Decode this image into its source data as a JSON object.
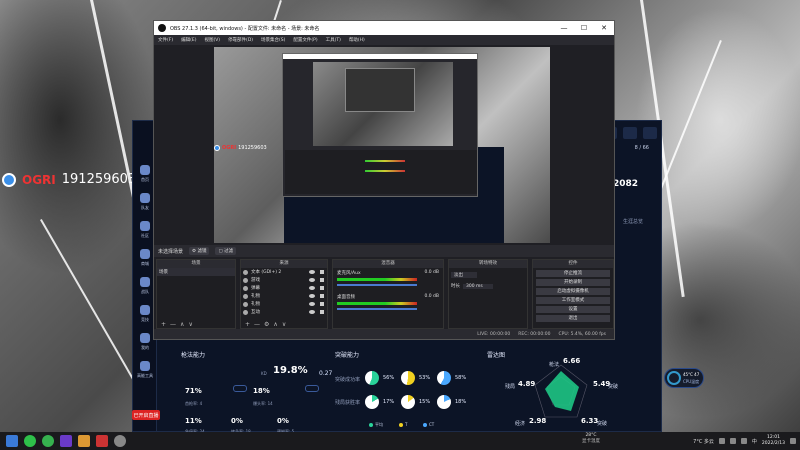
{
  "desktop": {
    "brand": "OGRI",
    "room_id": "191259603"
  },
  "obs": {
    "title": "OBS 27.1.3 (64-bit, windows) - 配置文件: 未命名 - 场景: 未命名",
    "menu": [
      "文件(F)",
      "编辑(E)",
      "视图(V)",
      "停靠部件(D)",
      "场景集合(S)",
      "配置文件(P)",
      "工具(T)",
      "帮助(H)"
    ],
    "window_controls": {
      "minimize": "—",
      "maximize": "☐",
      "close": "✕"
    },
    "scene_strip": {
      "name": "未选择场景",
      "btn1": "⚙ 滤镜",
      "btn2": "▢ 过滤"
    },
    "docks": {
      "scenes": {
        "title": "场景",
        "items": [
          "场景"
        ]
      },
      "sources": {
        "title": "来源",
        "items": [
          "文本 (GDI+) 2",
          "游戏",
          "弹幕",
          "礼物",
          "礼物",
          "互动"
        ]
      },
      "mixer": {
        "title": "混音器",
        "channels": [
          {
            "name": "麦克风/Aux",
            "db": "0.0 dB"
          },
          {
            "name": "桌面音频",
            "db": "0.0 dB"
          }
        ]
      },
      "transitions": {
        "title": "转场特效",
        "type": "淡出",
        "duration_label": "时长",
        "duration": "300 ms"
      },
      "controls": {
        "title": "控件",
        "buttons": [
          "停止推流",
          "开始录制",
          "启动虚拟摄像机",
          "工作室模式",
          "设置",
          "退出"
        ]
      }
    },
    "footer_symbols": {
      "add": "+",
      "remove": "—",
      "settings": "⚙",
      "up": "∧",
      "down": "∨"
    },
    "status": [
      "LIVE: 00:00:00",
      "REC: 00:00:00",
      "CPU: 5.4%, 60.00 fps"
    ]
  },
  "preview": {
    "brand": "OGRI",
    "room_id": "191259603"
  },
  "perf_app": {
    "sidebar": [
      "首页",
      "队友",
      "社区",
      "商城",
      "战队",
      "竞技",
      "我的",
      "高能工具"
    ],
    "ratio": "8 / 66",
    "score": "2082",
    "menu_hint": "生涯总览",
    "aim_title": "枪法能力",
    "aim_kd_label": "KD",
    "aim_value": "19.8%",
    "aim_delta": "0.27",
    "aim_stats": [
      {
        "v": "71%",
        "l": "首枪率: 4"
      },
      {
        "v": "18%",
        "l": "爆头率: 14"
      },
      {
        "v": "11%",
        "l": "急停率: 24"
      },
      {
        "v": "0%",
        "l": "转身率: 18"
      },
      {
        "v": "0%",
        "l": "预瞄率: 5"
      }
    ],
    "clutch_title": "突破能力",
    "clutch_labels": [
      "突破成功率",
      "残局获胜率"
    ],
    "clutch_values": [
      "56%",
      "53%",
      "58%",
      "17%",
      "15%",
      "18%"
    ],
    "legend": [
      "平均",
      "T",
      "CT"
    ],
    "radar_title": "雷达图",
    "radar": [
      {
        "label": "枪法",
        "value": "6.66"
      },
      {
        "label": "突破",
        "value": "5.49"
      },
      {
        "label": "残局",
        "value": "4.89"
      },
      {
        "label": "经济",
        "value": "2.98"
      },
      {
        "label": "突破",
        "value": "6.33"
      }
    ],
    "live_badge": "已开启直播"
  },
  "temp_widget": {
    "t1": "45°C 47",
    "t2": "CPU温度"
  },
  "taskbar": {
    "weather_center": {
      "temp": "28°C",
      "label": "显卡温度"
    },
    "weather": "7°C 多云",
    "ime": "中",
    "time": "12:01",
    "date": "2022/2/13"
  },
  "colors": {
    "accent": "#3b8fe8",
    "live": "#dd2222",
    "meter_green": "#22cc22",
    "pie_green": "#2ad39a",
    "pie_yellow": "#f0d020",
    "pie_blue": "#4aa8ff"
  }
}
